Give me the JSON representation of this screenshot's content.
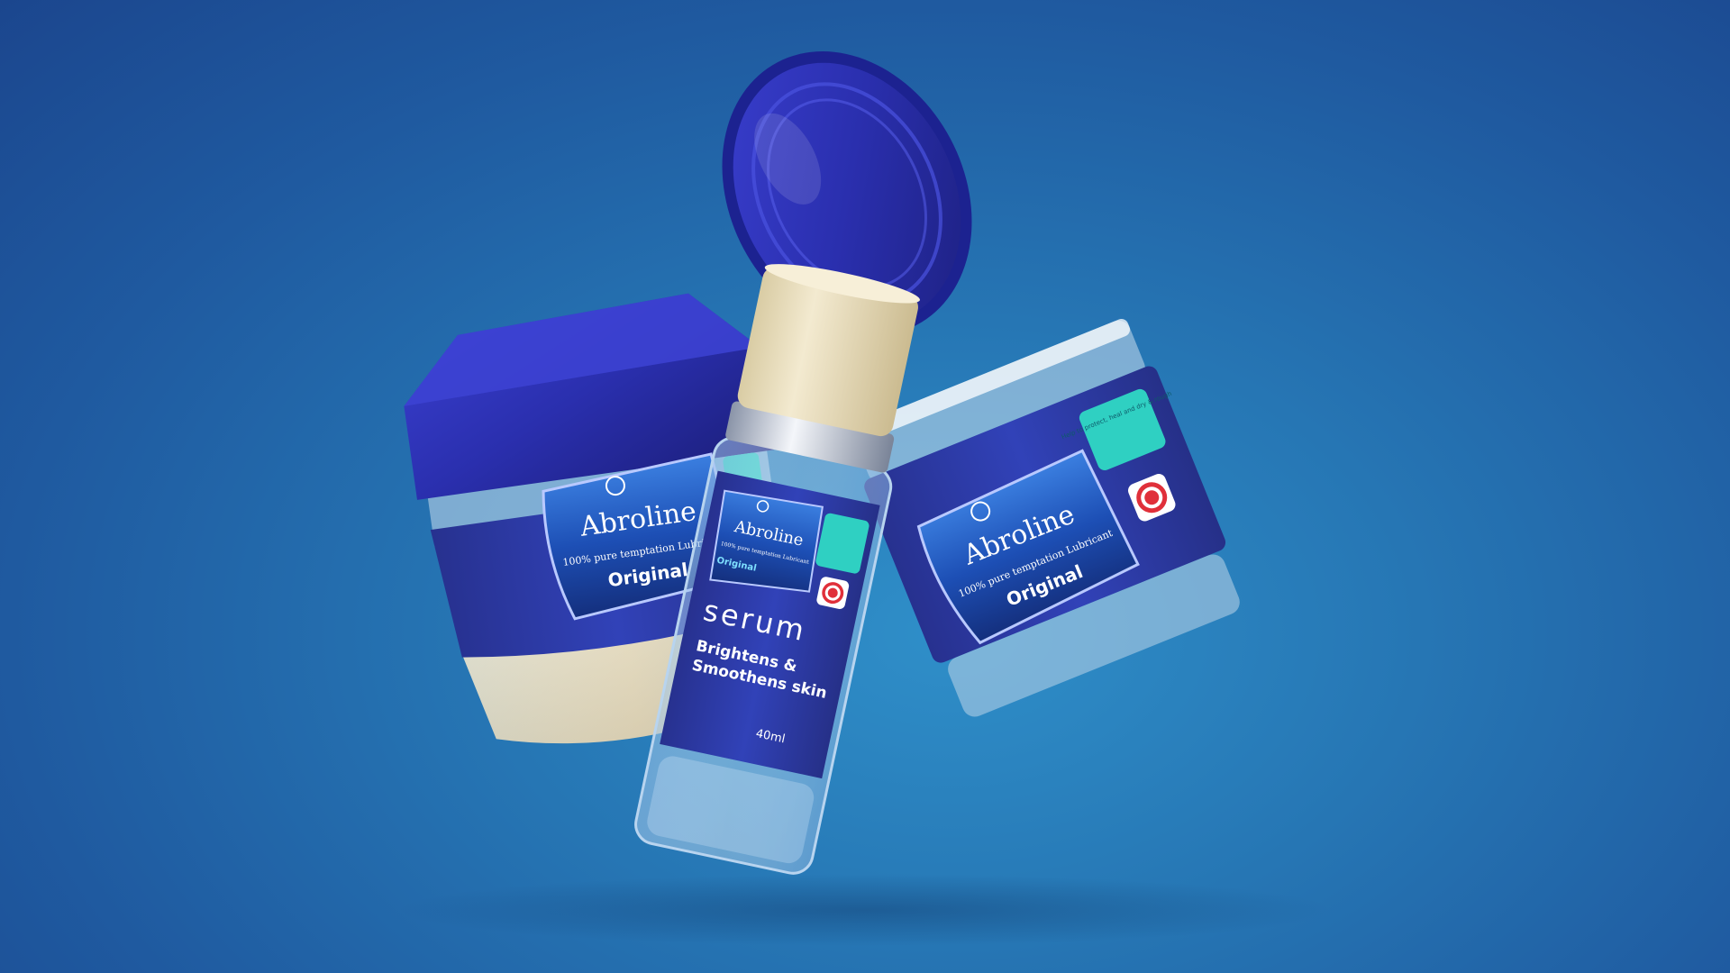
{
  "products": {
    "left_jar": {
      "brand": "Abroline",
      "tagline": "100% pure temptation Lubricant",
      "variant": "Original"
    },
    "serum_bottle": {
      "brand": "Abroline",
      "tagline": "100% pure temptation Lubricant",
      "variant": "Original",
      "product_type": "serum",
      "claim_line1": "Brightens &",
      "claim_line2": "Smoothens skin",
      "volume": "40ml"
    },
    "right_jar": {
      "brand": "Abroline",
      "tagline": "100% pure temptation Lubricant",
      "variant": "Original",
      "badge_text": "Help to protect, heal and dry & rough"
    }
  },
  "colors": {
    "background_center": "#2f8fc9",
    "background_edge": "#1b468e",
    "lid_blue": "#2a2fae",
    "label_blue": "#2b3aa8",
    "cream": "#e6d9b8",
    "teal_badge": "#2fd0c2",
    "red_badge": "#e0303a"
  }
}
